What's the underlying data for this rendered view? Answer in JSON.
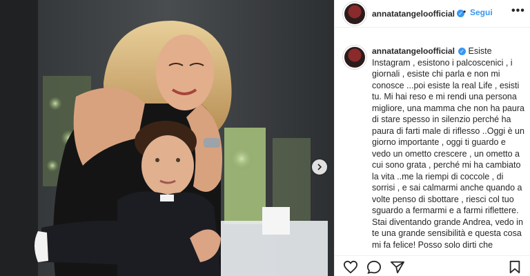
{
  "post": {
    "username": "annatatangeloofficial",
    "follow_label": "Segui",
    "separator": "•",
    "more_label": "•••",
    "verified_mark": "✓",
    "caption_username": "annatatangeloofficial",
    "caption_text": "Esiste Instagram , esistono i palcoscenici , i giornali , esiste chi parla e non mi conosce ...poi esiste la real Life , esisti tu. Mi hai reso e mi rendi una persona migliore, una mamma che non ha paura di stare spesso in silenzio perché ha paura di farti male di riflesso ..Oggi è un giorno importante , oggi ti guardo e vedo un ometto crescere , un ometto a cui sono grata , perché mi ha cambiato la vita ..me la riempi di coccole , di sorrisi , e sai calmarmi anche quando a volte penso di sbottare , riesci col tuo sguardo a fermarmi e a farmi riflettere. Stai diventando grande Andrea, vedo in te una grande sensibilità e questa cosa mi fa felice! Posso solo dirti che"
  },
  "colors": {
    "link_blue": "#3897f0",
    "text": "#262626",
    "divider": "#efefef"
  },
  "icons": {
    "like": "heart-icon",
    "comment": "comment-icon",
    "share": "paper-plane-icon",
    "save": "bookmark-icon",
    "next": "chevron-right-icon"
  }
}
